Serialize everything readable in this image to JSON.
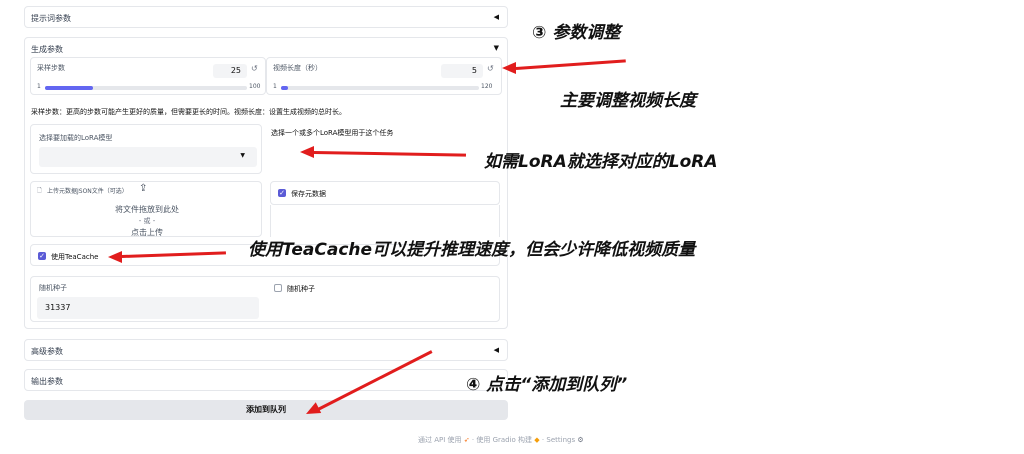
{
  "prompt_panel": {
    "label": "提示词参数",
    "collapse_icon": "triangle-left-icon"
  },
  "gen_panel": {
    "label": "生成参数",
    "collapse_icon": "triangle-down-icon",
    "steps": {
      "label": "采样步数",
      "value": "25",
      "min": "1",
      "max": "100",
      "fraction": 0.24
    },
    "duration": {
      "label": "视频长度（秒）",
      "value": "5",
      "min": "1",
      "max": "120",
      "fraction": 0.035
    },
    "desc": "采样步数：更高的步数可能产生更好的质量，但需要更长的时间。视频长度：设置生成视频的总时长。",
    "lora": {
      "label": "选择要加载的LoRA模型",
      "hint": "选择一个或多个LoRA模型用于这个任务"
    },
    "upload": {
      "label": "上传元数据JSON文件（可选）",
      "drop": "将文件拖放到此处",
      "or": "- 或 -",
      "click": "点击上传"
    },
    "save_meta": {
      "label": "保存元数据",
      "checked": true
    },
    "teacache": {
      "label": "使用TeaCache",
      "checked": true
    },
    "seed": {
      "label": "随机种子",
      "value": "31337"
    },
    "random_seed": {
      "label": "随机种子",
      "checked": false
    }
  },
  "advanced_panel": {
    "label": "高级参数",
    "collapse_icon": "triangle-left-icon"
  },
  "output_panel": {
    "label": "输出参数"
  },
  "add_queue_button": {
    "label": "添加到队列"
  },
  "footer": {
    "api": "通过 API 使用",
    "sep1": "·",
    "gradio": "使用 Gradio 构建",
    "sep2": "·",
    "settings": "Settings"
  },
  "annotations": {
    "a3": "③ 参数调整",
    "duration_note": "主要调整视频长度",
    "lora_note": "如需LoRA就选择对应的LoRA",
    "teacache_note": "使用TeaCache可以提升推理速度，但会少许降低视频质量",
    "a4": "④ 点击“添加到队列”"
  },
  "colors": {
    "accent": "#6366f1",
    "arrow": "#e11d1d"
  }
}
